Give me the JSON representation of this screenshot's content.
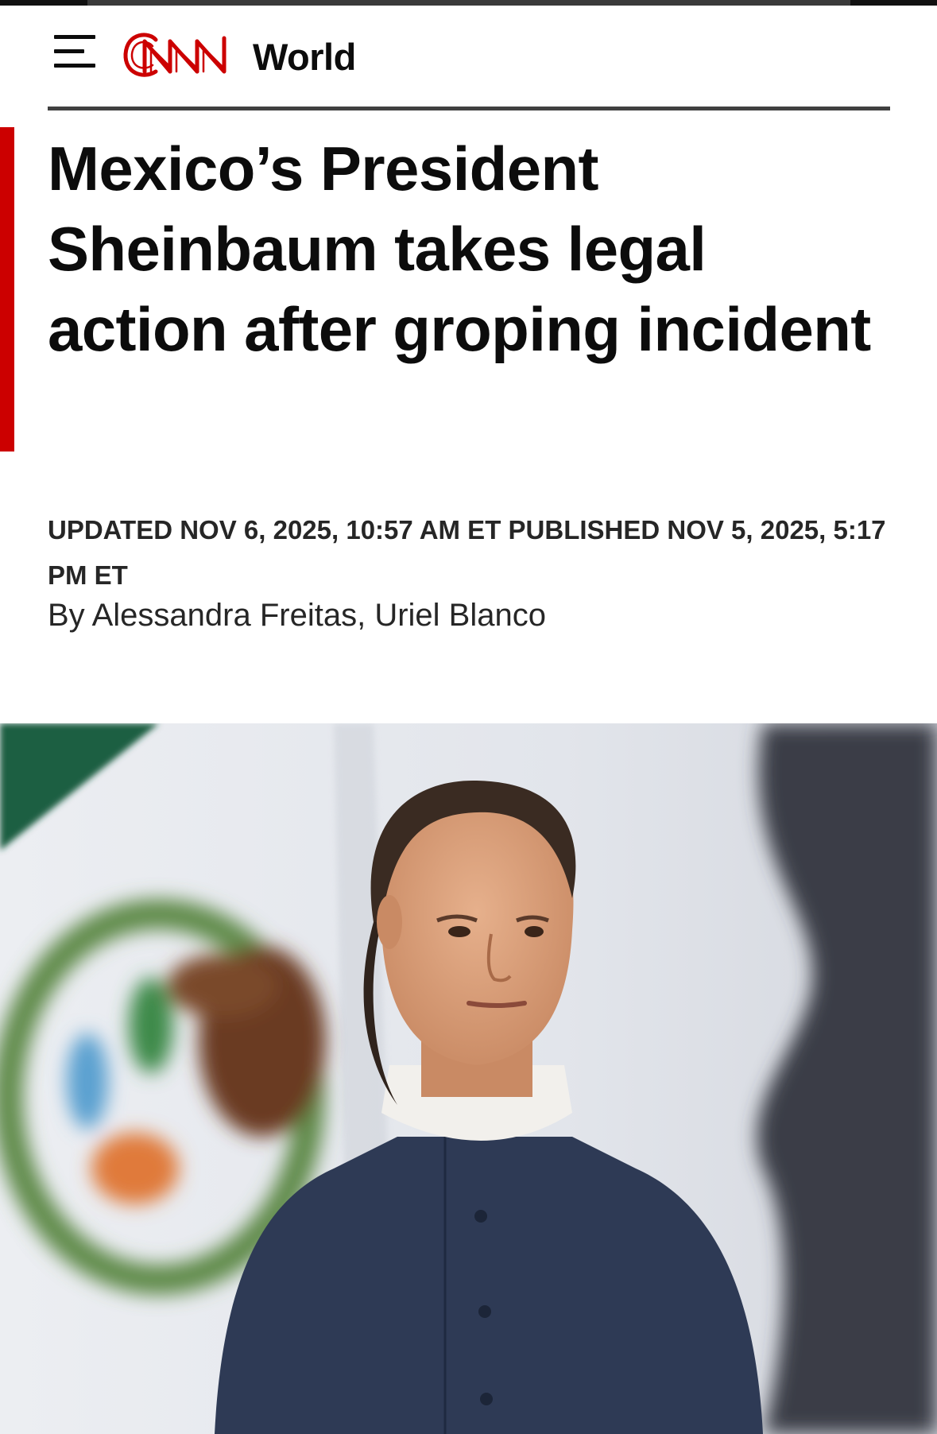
{
  "header": {
    "menu_icon": "hamburger-menu-icon",
    "logo_text": "CNN",
    "section": "World"
  },
  "article": {
    "headline": "Mexico’s President Sheinbaum takes legal action after groping incident",
    "timestamp": "UPDATED NOV 6, 2025, 10:57 AM ET PUBLISHED NOV 5, 2025, 5:17 PM ET",
    "byline": {
      "prefix": "By",
      "authors": [
        "Alessandra Freitas",
        "Uriel Blanco"
      ],
      "separator": ","
    }
  },
  "colors": {
    "brand_red": "#cc0000",
    "text": "#0c0c0c",
    "divider": "#404040"
  }
}
